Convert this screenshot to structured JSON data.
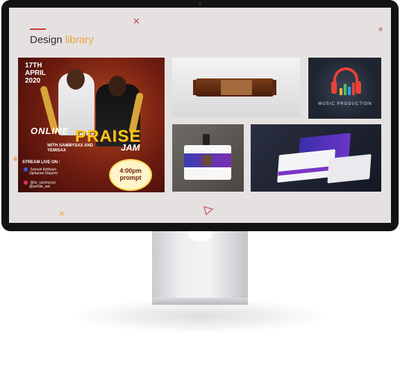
{
  "page": {
    "heading_prefix": "Design",
    "heading_highlight": "library"
  },
  "colors": {
    "accent_line": "#c93a3a",
    "highlight": "#e9a43a",
    "screen_bg": "#e6e1e1",
    "bezel": "#131313"
  },
  "gallery": {
    "flyer": {
      "date_day": "17TH",
      "date_month": "APRIL",
      "date_year": "2020",
      "title_online": "ONLINE",
      "title_praise": "PRAISE",
      "title_jam": "JAM",
      "with_line": "WITH SAMMYSAX AND YEMISAX",
      "stream_label": "STREAM LIVE ON :",
      "contact_name_1": "Samuel Adebayo",
      "contact_name_2": "Ojekanmi Olayemi",
      "handle_1": "@its_sammysax",
      "handle_2": "@yemite_sax",
      "time": "4:00pm",
      "time_note": "prompt"
    },
    "packaging": {
      "alt": "chocolate bar packaging mockup"
    },
    "logo": {
      "label": "MUSIC PRODUCTION"
    },
    "id_card": {
      "alt": "id card mockup"
    },
    "business_card": {
      "alt": "business card mockup"
    }
  },
  "decorations": [
    "x-icon",
    "circle-icon",
    "triangle-icon"
  ]
}
